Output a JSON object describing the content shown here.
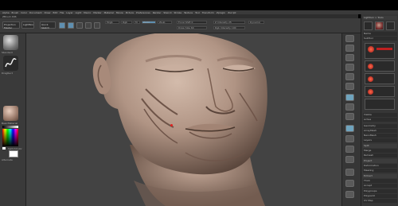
{
  "menu": {
    "items": [
      "Alpha",
      "Brush",
      "Color",
      "Document",
      "Draw",
      "Edit",
      "File",
      "Layer",
      "Light",
      "Macro",
      "Marker",
      "Material",
      "Movie",
      "Picture",
      "Preferences",
      "Render",
      "Stencil",
      "Stroke",
      "Texture",
      "Tool",
      "Transform",
      "Zplugin",
      "Zscript"
    ]
  },
  "titlebar": {
    "text": "ZBrush 4R6"
  },
  "toolbar": {
    "projection_label": "Projection Master",
    "lightbox_label": "LightBox",
    "quicksketch_label": "Quick Sketch",
    "slider_labels": [
      "Mrgb",
      "Rgb",
      "M",
      "Zadd",
      "Zsub",
      "Focal Shift 0",
      "Draw Size 64",
      "Z Intensity 25",
      "Rgb Intensity 100",
      "Dynamic"
    ],
    "active_mode": "Draw"
  },
  "left_shelf": {
    "labels": [
      "Standard",
      "DragRect",
      "BasicMaterial",
      "Gradient",
      "SwitchColor",
      "Alternate"
    ]
  },
  "tray": {
    "title": "Lightbox > Tools",
    "subtool_label": "SubTool",
    "rows": [
      "Geometry",
      "ArrayMesh",
      "NanoMesh",
      "Layers",
      "FiberMesh",
      "Geometry HD",
      "Preview",
      "Surface",
      "Deformation",
      "Masking",
      "Visibility",
      "Polygroups",
      "Contact",
      "Morph Target",
      "Polypaint",
      "UV Map",
      "Texture Map",
      "Displacement Map",
      "Normal Map",
      "Vector Displacement Map",
      "Display Properties",
      "Unified Skin",
      "Initialize",
      "Import",
      "Export"
    ],
    "slider_labels": [
      "Name",
      "Visible",
      "Active",
      "Split",
      "Merge",
      "Remesh",
      "Project",
      "Extract",
      "Thick",
      "Accept"
    ]
  },
  "colors": {
    "background": "#434343",
    "ui_panel": "#3a3a3a",
    "accent": "#6fa4be",
    "clay": "#b49a8a",
    "red_marker": "#e02020"
  }
}
